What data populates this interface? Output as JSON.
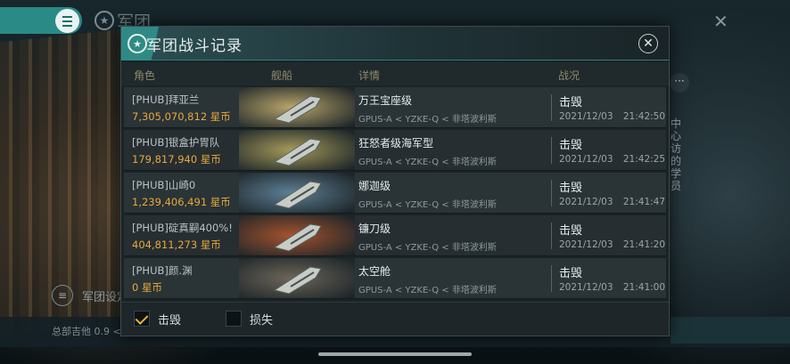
{
  "background": {
    "legion_title": "军团",
    "legion_settings_label": "军团设定",
    "bottom_text": "总部吉他 0.9 <",
    "side_text": "中心访的学员",
    "menu_icon": "menu-icon",
    "close_icon": "close-icon"
  },
  "dialog": {
    "title": "军团战斗记录",
    "columns": [
      "角色",
      "舰船",
      "详情",
      "战况"
    ],
    "rows": [
      {
        "who": "[PHUB]拜亚兰",
        "value": "7,305,070,812 星币",
        "ship": "万王宝座级",
        "route": "GPUS-A < YZKE-Q < 非塔波利斯",
        "status": "击毁",
        "date": "2021/12/03",
        "time": "21:42:50",
        "tone": "#b8a56a"
      },
      {
        "who": "[PHUB]银盒护胃队",
        "value": "179,817,940 星币",
        "ship": "狂怒者级海军型",
        "route": "GPUS-A < YZKE-Q < 非塔波利斯",
        "status": "击毁",
        "date": "2021/12/03",
        "time": "21:42:25",
        "tone": "#a49a5a"
      },
      {
        "who": "[PHUB]山崎0",
        "value": "1,239,406,491 星币",
        "ship": "娜迦级",
        "route": "GPUS-A < YZKE-Q < 非塔波利斯",
        "status": "击毁",
        "date": "2021/12/03",
        "time": "21:41:47",
        "tone": "#5d7f95"
      },
      {
        "who": "[PHUB]碇真嗣400%!",
        "value": "404,811,273 星币",
        "ship": "镰刀级",
        "route": "GPUS-A < YZKE-Q < 非塔波利斯",
        "status": "击毁",
        "date": "2021/12/03",
        "time": "21:41:20",
        "tone": "#a5532e"
      },
      {
        "who": "[PHUB]颜.渊",
        "value": "0 星币",
        "ship": "太空舱",
        "route": "GPUS-A < YZKE-Q < 非塔波利斯",
        "status": "击毁",
        "date": "2021/12/03",
        "time": "21:41:00",
        "tone": "#6d665a"
      }
    ],
    "filters": [
      {
        "label": "击毁",
        "checked": true
      },
      {
        "label": "损失",
        "checked": false
      }
    ]
  },
  "colors": {
    "accent": "#2f8a85",
    "isk": "#e6a93c",
    "checkmark": "#e8b43a"
  }
}
